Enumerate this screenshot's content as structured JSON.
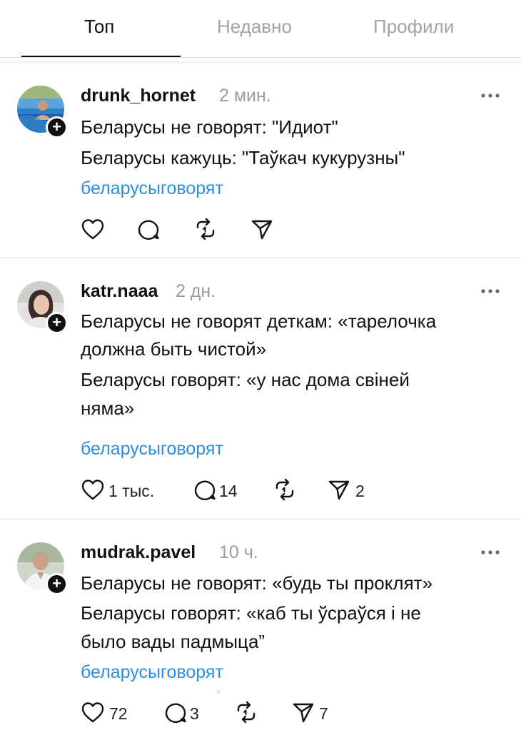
{
  "tabs": [
    {
      "label": "Топ",
      "active": true
    },
    {
      "label": "Недавно",
      "active": false
    },
    {
      "label": "Профили",
      "active": false
    }
  ],
  "posts": [
    {
      "username": "drunk_hornet",
      "time": "2 мин.",
      "lines": [
        "Беларусы не говорят: \"Идиот\"",
        "Беларусы кажуць: \"Таўкач кукурузны\""
      ],
      "hashtag": "беларусыговорят",
      "likes": "",
      "comments": "",
      "reposts": "",
      "shares": ""
    },
    {
      "username": "katr.naaa",
      "time": "2 дн.",
      "lines": [
        "Беларусы не говорят деткам: «тарелочка",
        "должна быть чистой»",
        "Беларусы говорят: «у нас дома свіней",
        "няма»"
      ],
      "hashtag": "беларусыговорят",
      "likes": "1 тыс.",
      "comments": "14",
      "reposts": "",
      "shares": "2"
    },
    {
      "username": "mudrak.pavel",
      "time": "10 ч.",
      "lines": [
        "Беларусы не говорят: «будь ты проклят»",
        "Беларусы говорят: «каб ты ўсраўся і не",
        "было вады падмыца”"
      ],
      "hashtag": "беларусыговорят",
      "likes": "72",
      "comments": "3",
      "reposts": "",
      "shares": "7"
    }
  ],
  "icons": {
    "follow_badge": "plus-icon",
    "more": "more-horizontal-icon",
    "like": "heart-icon",
    "comment": "comment-icon",
    "repost": "repost-icon",
    "share": "send-icon"
  },
  "colors": {
    "text": "#111111",
    "muted": "#9b9b9b",
    "inactive_tab": "#a3a3a3",
    "hashtag": "#2b8ee0",
    "divider": "#e0e0e0"
  }
}
